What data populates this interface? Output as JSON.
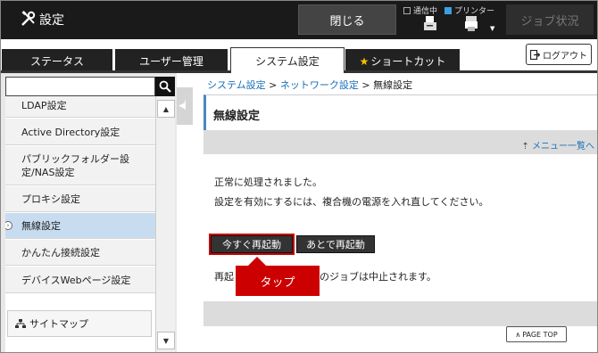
{
  "header": {
    "title": "設定",
    "close_label": "閉じる",
    "comm_label": "通信中",
    "printer_label": "プリンター",
    "job_status_label": "ジョブ状況"
  },
  "tabs": [
    {
      "label": "ステータス",
      "active": false
    },
    {
      "label": "ユーザー管理",
      "active": false
    },
    {
      "label": "システム設定",
      "active": true
    },
    {
      "label": "ショートカット",
      "active": false
    }
  ],
  "logout_label": "ログアウト",
  "sidebar": {
    "search_value": "",
    "items": [
      {
        "label": "LDAP設定"
      },
      {
        "label": "Active Directory設定"
      },
      {
        "label": "パブリックフォルダー設\n定/NAS設定"
      },
      {
        "label": "プロキシ設定"
      },
      {
        "label": "無線設定",
        "active": true
      },
      {
        "label": "かんたん接続設定"
      },
      {
        "label": "デバイスWebページ設定"
      }
    ],
    "sitemap_label": "サイトマップ"
  },
  "breadcrumb": {
    "item1": "システム設定",
    "item2": "ネットワーク設定",
    "current": "無線設定",
    "sep": " > "
  },
  "main": {
    "page_title": "無線設定",
    "menu_link": "メニュー一覧へ",
    "message1": "正常に処理されました。",
    "message2": "設定を有効にするには、複合機の電源を入れ直してください。",
    "restart_now": "今すぐ再起動",
    "restart_later": "あとで再起動",
    "note_left": "再起",
    "note_right": "のジョブは中止されます。",
    "callout": "タップ",
    "page_top": "PAGE TOP"
  },
  "colors": {
    "header_bg": "#1a1a1a",
    "link": "#1a6fb5",
    "active_item": "#c8dcf0",
    "callout": "#cc0000"
  }
}
